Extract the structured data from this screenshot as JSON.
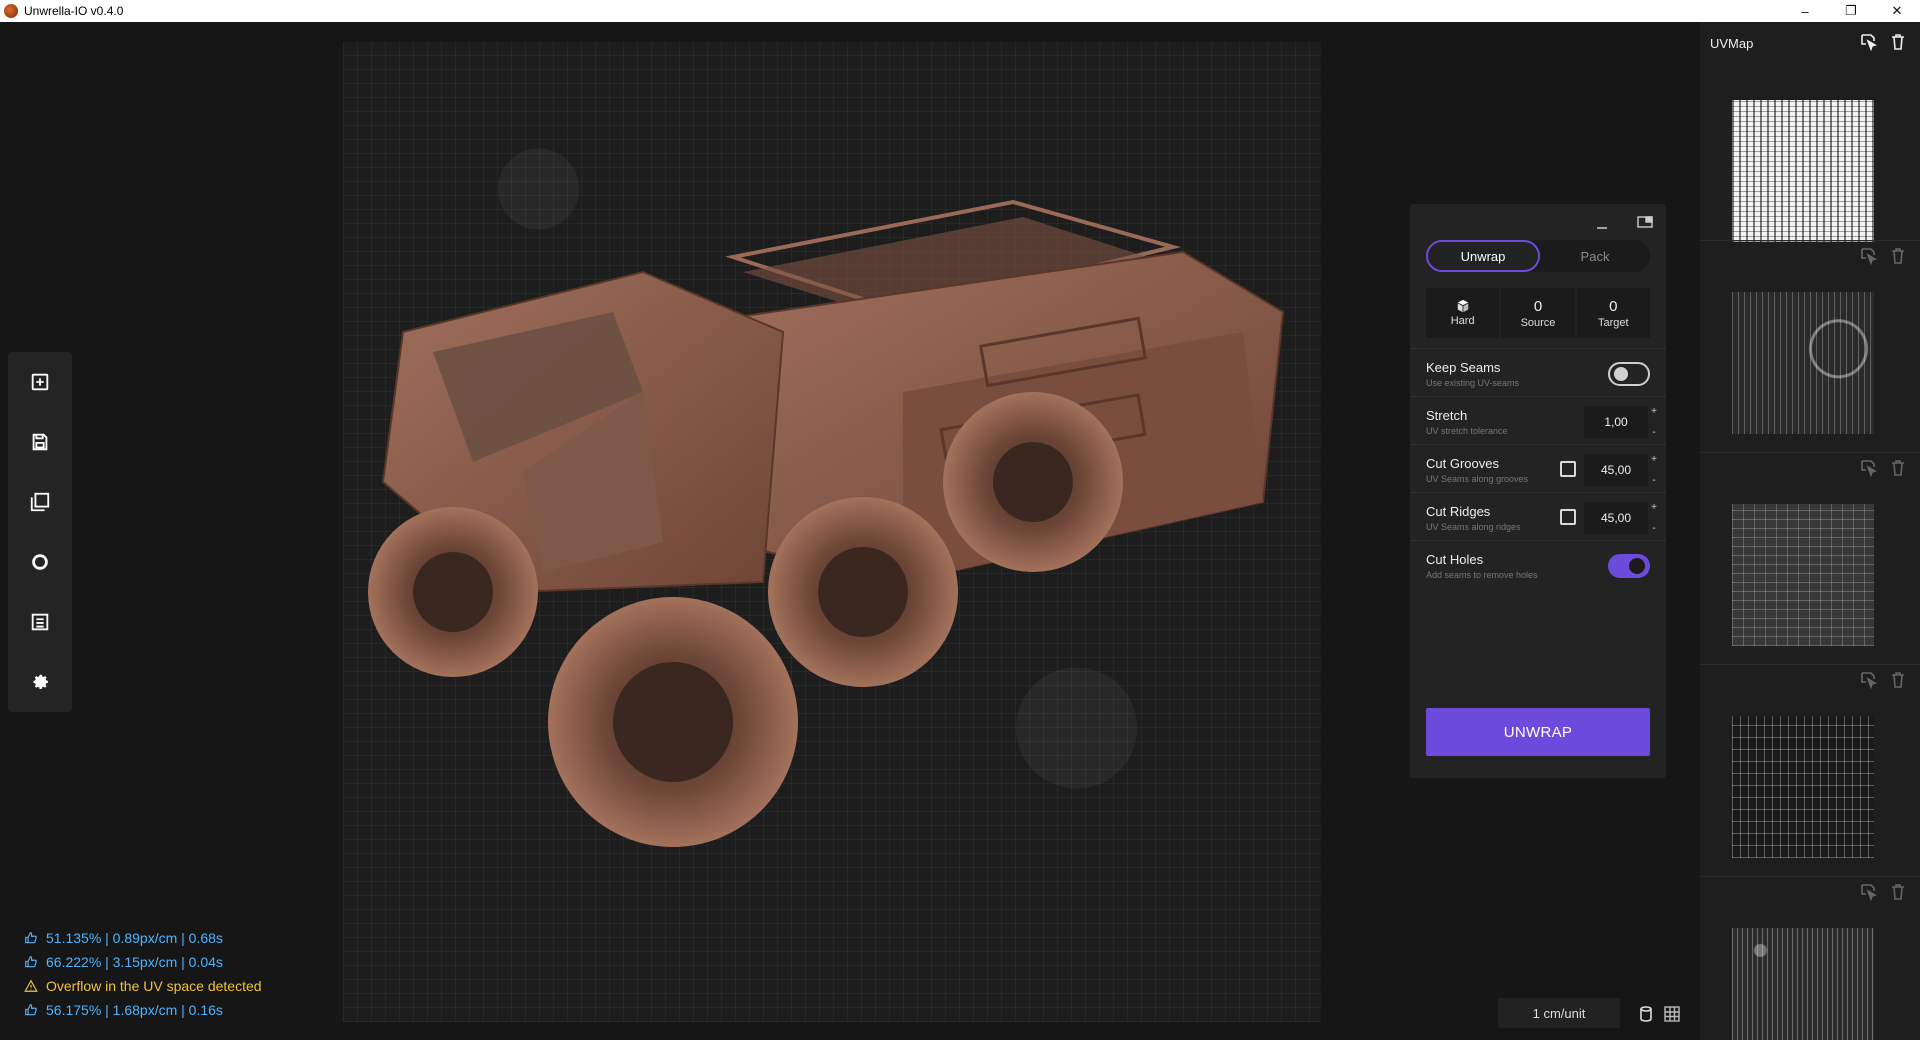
{
  "window": {
    "title": "Unwrella-IO v0.4.0",
    "controls": [
      "–",
      "❐",
      "✕"
    ]
  },
  "toolbar": {
    "items": [
      "new-icon",
      "save-icon",
      "layers-icon",
      "circle-icon",
      "list-icon",
      "gear-icon"
    ]
  },
  "stats": [
    {
      "text": "51.135%  |  0.89px/cm  |  0.68s",
      "kind": "ok"
    },
    {
      "text": "66.222%  |  3.15px/cm  |  0.04s",
      "kind": "ok"
    },
    {
      "text": "Overflow in the UV space detected",
      "kind": "warn"
    },
    {
      "text": "56.175%  |  1.68px/cm  |  0.16s",
      "kind": "ok"
    }
  ],
  "bottom": {
    "unit": "1 cm/unit"
  },
  "panel": {
    "tabs": {
      "unwrap": "Unwrap",
      "pack": "Pack"
    },
    "cards": {
      "hard": {
        "label": "Hard"
      },
      "source": {
        "value": "0",
        "label": "Source"
      },
      "target": {
        "value": "0",
        "label": "Target"
      }
    },
    "keep_seams": {
      "title": "Keep Seams",
      "sub": "Use existing UV-seams",
      "enabled": false
    },
    "stretch": {
      "title": "Stretch",
      "sub": "UV stretch tolerance",
      "value": "1,00"
    },
    "cut_grooves": {
      "title": "Cut Grooves",
      "sub": "UV Seams along grooves",
      "checked": false,
      "value": "45,00"
    },
    "cut_ridges": {
      "title": "Cut Ridges",
      "sub": "UV Seams along ridges",
      "checked": false,
      "value": "45,00"
    },
    "cut_holes": {
      "title": "Cut Holes",
      "sub": "Add seams to remove holes",
      "enabled": true
    },
    "stepper": {
      "plus": "+",
      "minus": "-"
    },
    "unwrap_button": "UNWRAP"
  },
  "uvmap": {
    "title": "UVMap"
  },
  "colors": {
    "accent": "#6c4bdc",
    "info": "#4fb3ff",
    "warning": "#f0c23a",
    "model": "#8a5a48"
  }
}
